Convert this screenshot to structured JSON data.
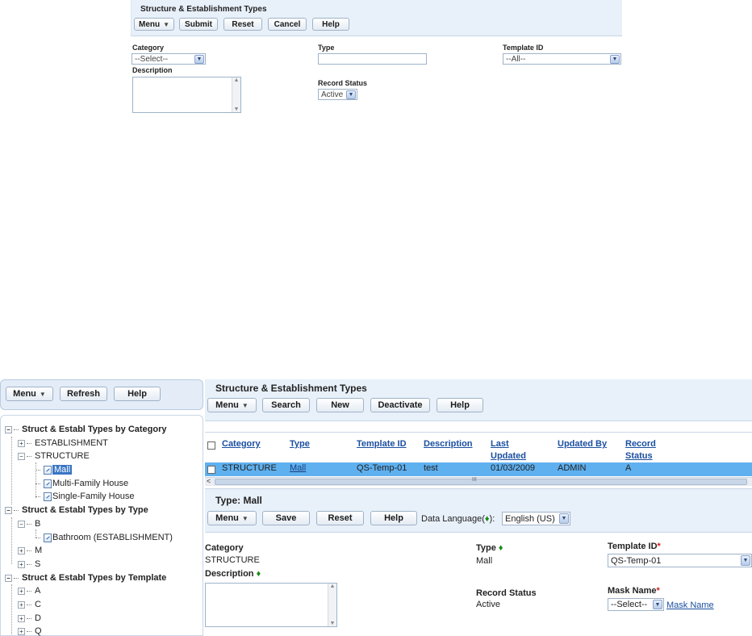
{
  "top_dialog": {
    "title": "Structure & Establishment Types",
    "buttons": {
      "menu": "Menu",
      "submit": "Submit",
      "reset": "Reset",
      "cancel": "Cancel",
      "help": "Help"
    },
    "category_label": "Category",
    "category_value": "--Select--",
    "type_label": "Type",
    "type_value": "",
    "template_label": "Template ID",
    "template_value": "--All--",
    "description_label": "Description",
    "record_status_label": "Record Status",
    "record_status_value": "Active"
  },
  "left_toolbar": {
    "menu": "Menu",
    "refresh": "Refresh",
    "help": "Help"
  },
  "tree": {
    "by_category": "Struct & Establ Types by Category",
    "establishment": "ESTABLISHMENT",
    "structure": "STRUCTURE",
    "mall": "Mall",
    "multi_family": "Multi-Family House",
    "single_family": "Single-Family House",
    "by_type": "Struct & Establ Types by Type",
    "type_b": "B",
    "bathroom": "Bathroom (ESTABLISHMENT)",
    "type_m": "M",
    "type_s": "S",
    "by_template": "Struct & Establ Types by Template",
    "tpl_a": "A",
    "tpl_c": "C",
    "tpl_d": "D",
    "tpl_q": "Q"
  },
  "main": {
    "title": "Structure & Establishment Types",
    "buttons": {
      "menu": "Menu",
      "search": "Search",
      "new": "New",
      "deactivate": "Deactivate",
      "help": "Help"
    },
    "columns": {
      "category": "Category",
      "type": "Type",
      "template_id": "Template ID",
      "description": "Description",
      "last": "Last",
      "updated": "Updated",
      "updated_by": "Updated By",
      "record": "Record",
      "status": "Status"
    },
    "row": {
      "category": "STRUCTURE",
      "type": "Mall",
      "template_id": "QS-Temp-01",
      "description": "test",
      "last_updated": "01/03/2009",
      "updated_by": "ADMIN",
      "record_status": "A"
    },
    "scroll_thumb": "III"
  },
  "detail": {
    "title": "Type: Mall",
    "buttons": {
      "menu": "Menu",
      "save": "Save",
      "reset": "Reset",
      "help": "Help"
    },
    "data_language_label_pre": "Data Language(",
    "data_language_label_post": "):",
    "data_language_value": "English (US)",
    "category_label": "Category",
    "category_value": "STRUCTURE",
    "type_label": "Type",
    "type_value": "Mall",
    "template_label": "Template ID",
    "template_value": "QS-Temp-01",
    "description_label": "Description",
    "record_status_label": "Record Status",
    "record_status_value": "Active",
    "mask_name_label": "Mask Name",
    "mask_name_value": "--Select--",
    "mask_name_link": "Mask Name",
    "required_mark": "*",
    "diamond": "♦"
  }
}
